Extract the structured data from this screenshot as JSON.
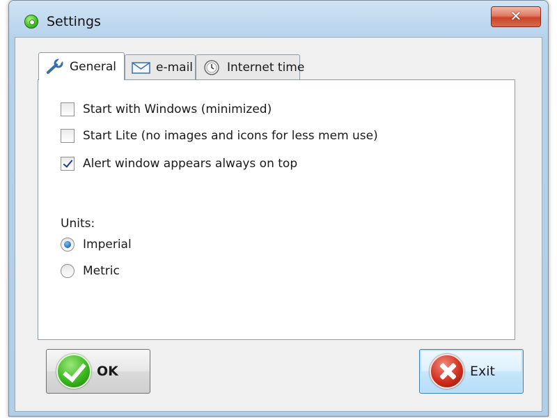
{
  "window": {
    "title": "Settings",
    "close_label": "✕"
  },
  "tabs": [
    {
      "label": "General",
      "icon": "wrench-icon",
      "active": true
    },
    {
      "label": "e-mail",
      "icon": "envelope-icon",
      "active": false
    },
    {
      "label": "Internet time",
      "icon": "clock-icon",
      "active": false
    }
  ],
  "general": {
    "options": [
      {
        "label": "Start with Windows (minimized)",
        "checked": false
      },
      {
        "label": "Start Lite (no images and icons for less mem use)",
        "checked": false
      },
      {
        "label": "Alert window appears always on top",
        "checked": true
      }
    ],
    "units_label": "Units:",
    "units": [
      {
        "label": "Imperial",
        "selected": true
      },
      {
        "label": "Metric",
        "selected": false
      }
    ]
  },
  "buttons": {
    "ok_label": "OK",
    "exit_label": "Exit"
  },
  "colors": {
    "title_gradient_top": "#cfe3f4",
    "close_button": "#c9452a",
    "ok_icon": "#3cb81f",
    "exit_icon": "#d2301e",
    "radio_selected": "#1e6fb8"
  }
}
